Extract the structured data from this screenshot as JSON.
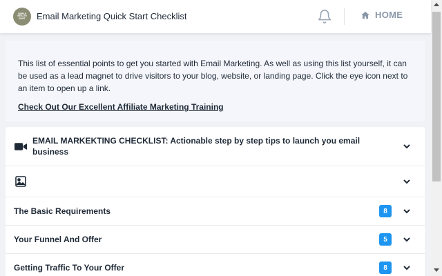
{
  "header": {
    "logo_text": "SIMPLE WEALTH SHIFT",
    "title": "Email Marketing Quick Start Checklist",
    "notification_icon": "bell-icon",
    "home_icon": "house-icon",
    "home_label": "HOME"
  },
  "intro": {
    "text": "This list of essential points to get you started with Email Marketing. As well as using this list yourself, it can be used as a lead magnet to drive visitors to your blog, website, or landing page. Click the eye icon next to an item to open up a link.",
    "link_label": "Check Out Our Excellent Affiliate Marketing Training"
  },
  "checklist": {
    "items": [
      {
        "label": "EMAIL MARKEKTING CHECKLIST: Actionable step by step tips to launch you email business",
        "icon": "video-camera-icon"
      },
      {
        "label": "",
        "icon": "image-icon"
      },
      {
        "label": "The Basic Requirements",
        "count": "8"
      },
      {
        "label": "Your Funnel And Offer",
        "count": "5"
      },
      {
        "label": "Getting Traffic To Your Offer",
        "count": "8"
      }
    ]
  },
  "colors": {
    "badge": "#1e95f0",
    "accent_text": "#1f2a37",
    "home": "#8a97a8",
    "background": "#f1f2f6"
  }
}
